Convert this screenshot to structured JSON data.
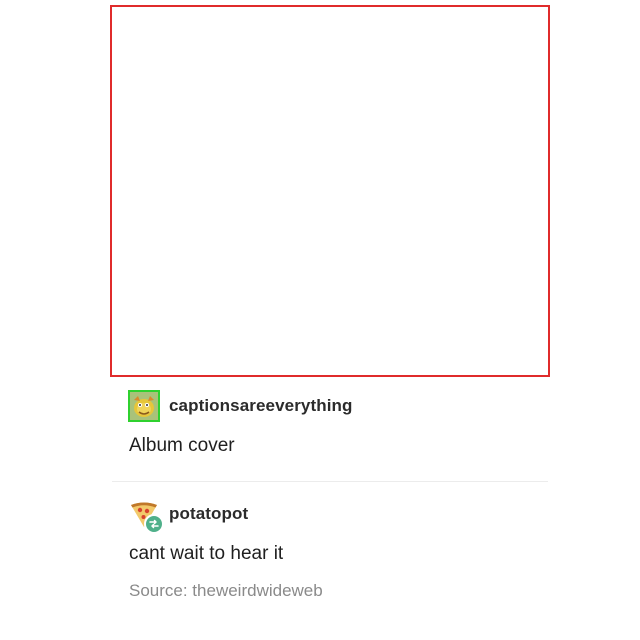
{
  "image": {
    "alt": "",
    "border_color": "#e02b2b"
  },
  "posts": [
    {
      "username": "captionsareeverything",
      "avatar_icon": "cartoon-avatar-icon",
      "text": "Album cover"
    },
    {
      "username": "potatopot",
      "avatar_icon": "pizza-slice-icon",
      "badge_icon": "reblog-icon",
      "text": "cant wait to hear it",
      "source": "Source: theweirdwideweb"
    }
  ],
  "colors": {
    "avatar_highlight": "#2fd12f",
    "reblog_badge": "#4fb08a",
    "source_text": "#8a8a8a"
  }
}
